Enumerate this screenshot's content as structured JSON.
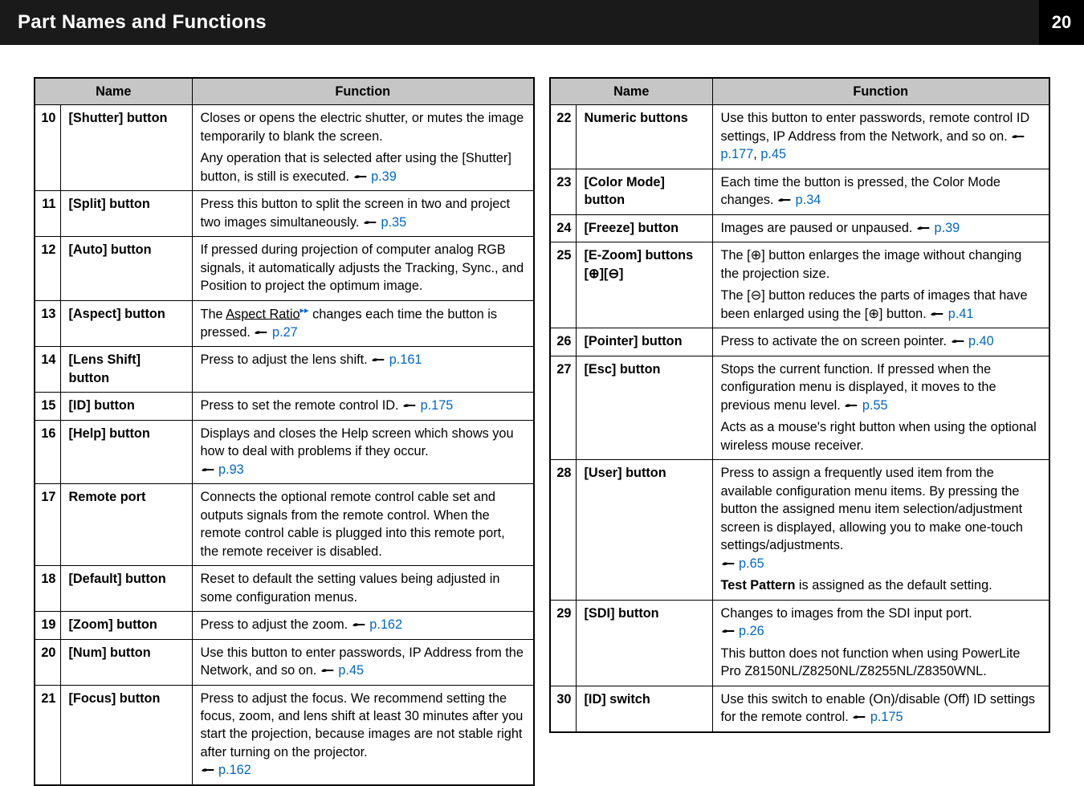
{
  "header": {
    "title": "Part Names and Functions",
    "page": "20"
  },
  "th": {
    "name": "Name",
    "func": "Function"
  },
  "left": [
    {
      "n": "10",
      "name": "[Shutter] button",
      "paras": [
        {
          "t": "Closes or opens the electric shutter, or mutes the image temporarily to blank the screen."
        },
        {
          "t": "Any operation that is selected after using the [Shutter] button, is still is executed. ",
          "ref": "p.39"
        }
      ]
    },
    {
      "n": "11",
      "name": "[Split] button",
      "paras": [
        {
          "t": "Press this button to split the screen in two and project two images simultaneously. ",
          "ref": "p.35"
        }
      ]
    },
    {
      "n": "12",
      "name": "[Auto] button",
      "paras": [
        {
          "t": "If pressed during projection of computer analog RGB signals, it automatically adjusts the Tracking, Sync., and Position to project the optimum image."
        }
      ]
    },
    {
      "n": "13",
      "name": "[Aspect] button",
      "paras": [
        {
          "pre": "The ",
          "glos": "Aspect Ratio",
          "post": " changes each time the button is pressed. ",
          "ref": "p.27"
        }
      ]
    },
    {
      "n": "14",
      "name": "[Lens Shift] button",
      "paras": [
        {
          "t": "Press to adjust the lens shift. ",
          "ref": "p.161"
        }
      ]
    },
    {
      "n": "15",
      "name": "[ID] button",
      "paras": [
        {
          "t": "Press to set the remote control ID. ",
          "ref": "p.175"
        }
      ]
    },
    {
      "n": "16",
      "name": "[Help] button",
      "paras": [
        {
          "t": "Displays and closes the Help screen which shows you how to deal with problems if they occur. ",
          "refonly": "p.93"
        }
      ]
    },
    {
      "n": "17",
      "name": "Remote port",
      "paras": [
        {
          "t": "Connects the optional remote control cable set and outputs signals from the remote control. When the remote control cable is plugged into this remote port, the remote receiver is disabled."
        }
      ]
    },
    {
      "n": "18",
      "name": "[Default] button",
      "paras": [
        {
          "t": "Reset to default the setting values being adjusted in some configuration menus."
        }
      ]
    },
    {
      "n": "19",
      "name": "[Zoom] button",
      "paras": [
        {
          "t": "Press to adjust the zoom. ",
          "ref": "p.162"
        }
      ]
    },
    {
      "n": "20",
      "name": "[Num] button",
      "paras": [
        {
          "t": "Use this button to enter passwords, IP Address from the Network, and so on. ",
          "ref": "p.45"
        }
      ]
    },
    {
      "n": "21",
      "name": "[Focus] button",
      "paras": [
        {
          "t": "Press to adjust the focus. We recommend setting the focus, zoom, and lens shift at least 30 minutes after you start the projection, because images are not stable right after turning on the projector. ",
          "refonly": "p.162"
        }
      ]
    }
  ],
  "right": [
    {
      "n": "22",
      "name": "Numeric buttons",
      "paras": [
        {
          "t": "Use this button to enter passwords, remote control ID settings, IP Address from the Network, and so on. ",
          "ref2": [
            "p.177",
            "p.45"
          ]
        }
      ]
    },
    {
      "n": "23",
      "name": "[Color Mode] button",
      "paras": [
        {
          "t": "Each time the button is pressed, the Color Mode changes. ",
          "ref": "p.34"
        }
      ]
    },
    {
      "n": "24",
      "name": "[Freeze] button",
      "paras": [
        {
          "t": "Images are paused or unpaused. ",
          "ref": "p.39"
        }
      ]
    },
    {
      "n": "25",
      "name": "[E-Zoom] buttons",
      "sub": "[⊕][⊖]",
      "paras": [
        {
          "html": "The [⊕] button enlarges the image without changing the projection size."
        },
        {
          "html": "The [⊖] button reduces the parts of images that have been enlarged using the [⊕] button. ",
          "ref": "p.41"
        }
      ]
    },
    {
      "n": "26",
      "name": "[Pointer] button",
      "paras": [
        {
          "t": "Press to activate the on screen pointer. ",
          "ref": "p.40"
        }
      ]
    },
    {
      "n": "27",
      "name": "[Esc] button",
      "paras": [
        {
          "t": "Stops the current function. If pressed when the configuration menu is displayed, it moves to the previous menu level. ",
          "ref": "p.55"
        },
        {
          "t": "Acts as a mouse's right button when using the optional wireless mouse receiver."
        }
      ]
    },
    {
      "n": "28",
      "name": "[User] button",
      "paras": [
        {
          "t": "Press to assign a frequently used item from the available configuration menu items. By pressing the button the assigned menu item selection/adjustment screen is displayed, allowing you to make one-touch settings/adjustments. ",
          "refonly": "p.65"
        },
        {
          "boldlead": "Test Pattern",
          "rest": " is assigned as the default setting."
        }
      ]
    },
    {
      "n": "29",
      "name": "[SDI] button",
      "paras": [
        {
          "t": "Changes to images from the SDI input port. ",
          "refonly": "p.26"
        },
        {
          "t": "This button does not function when using PowerLite Pro Z8150NL/Z8250NL/Z8255NL/Z8350WNL."
        }
      ]
    },
    {
      "n": "30",
      "name": "[ID] switch",
      "paras": [
        {
          "t": "Use this switch to enable (On)/disable (Off) ID settings for the remote control. ",
          "ref": "p.175"
        }
      ]
    }
  ]
}
